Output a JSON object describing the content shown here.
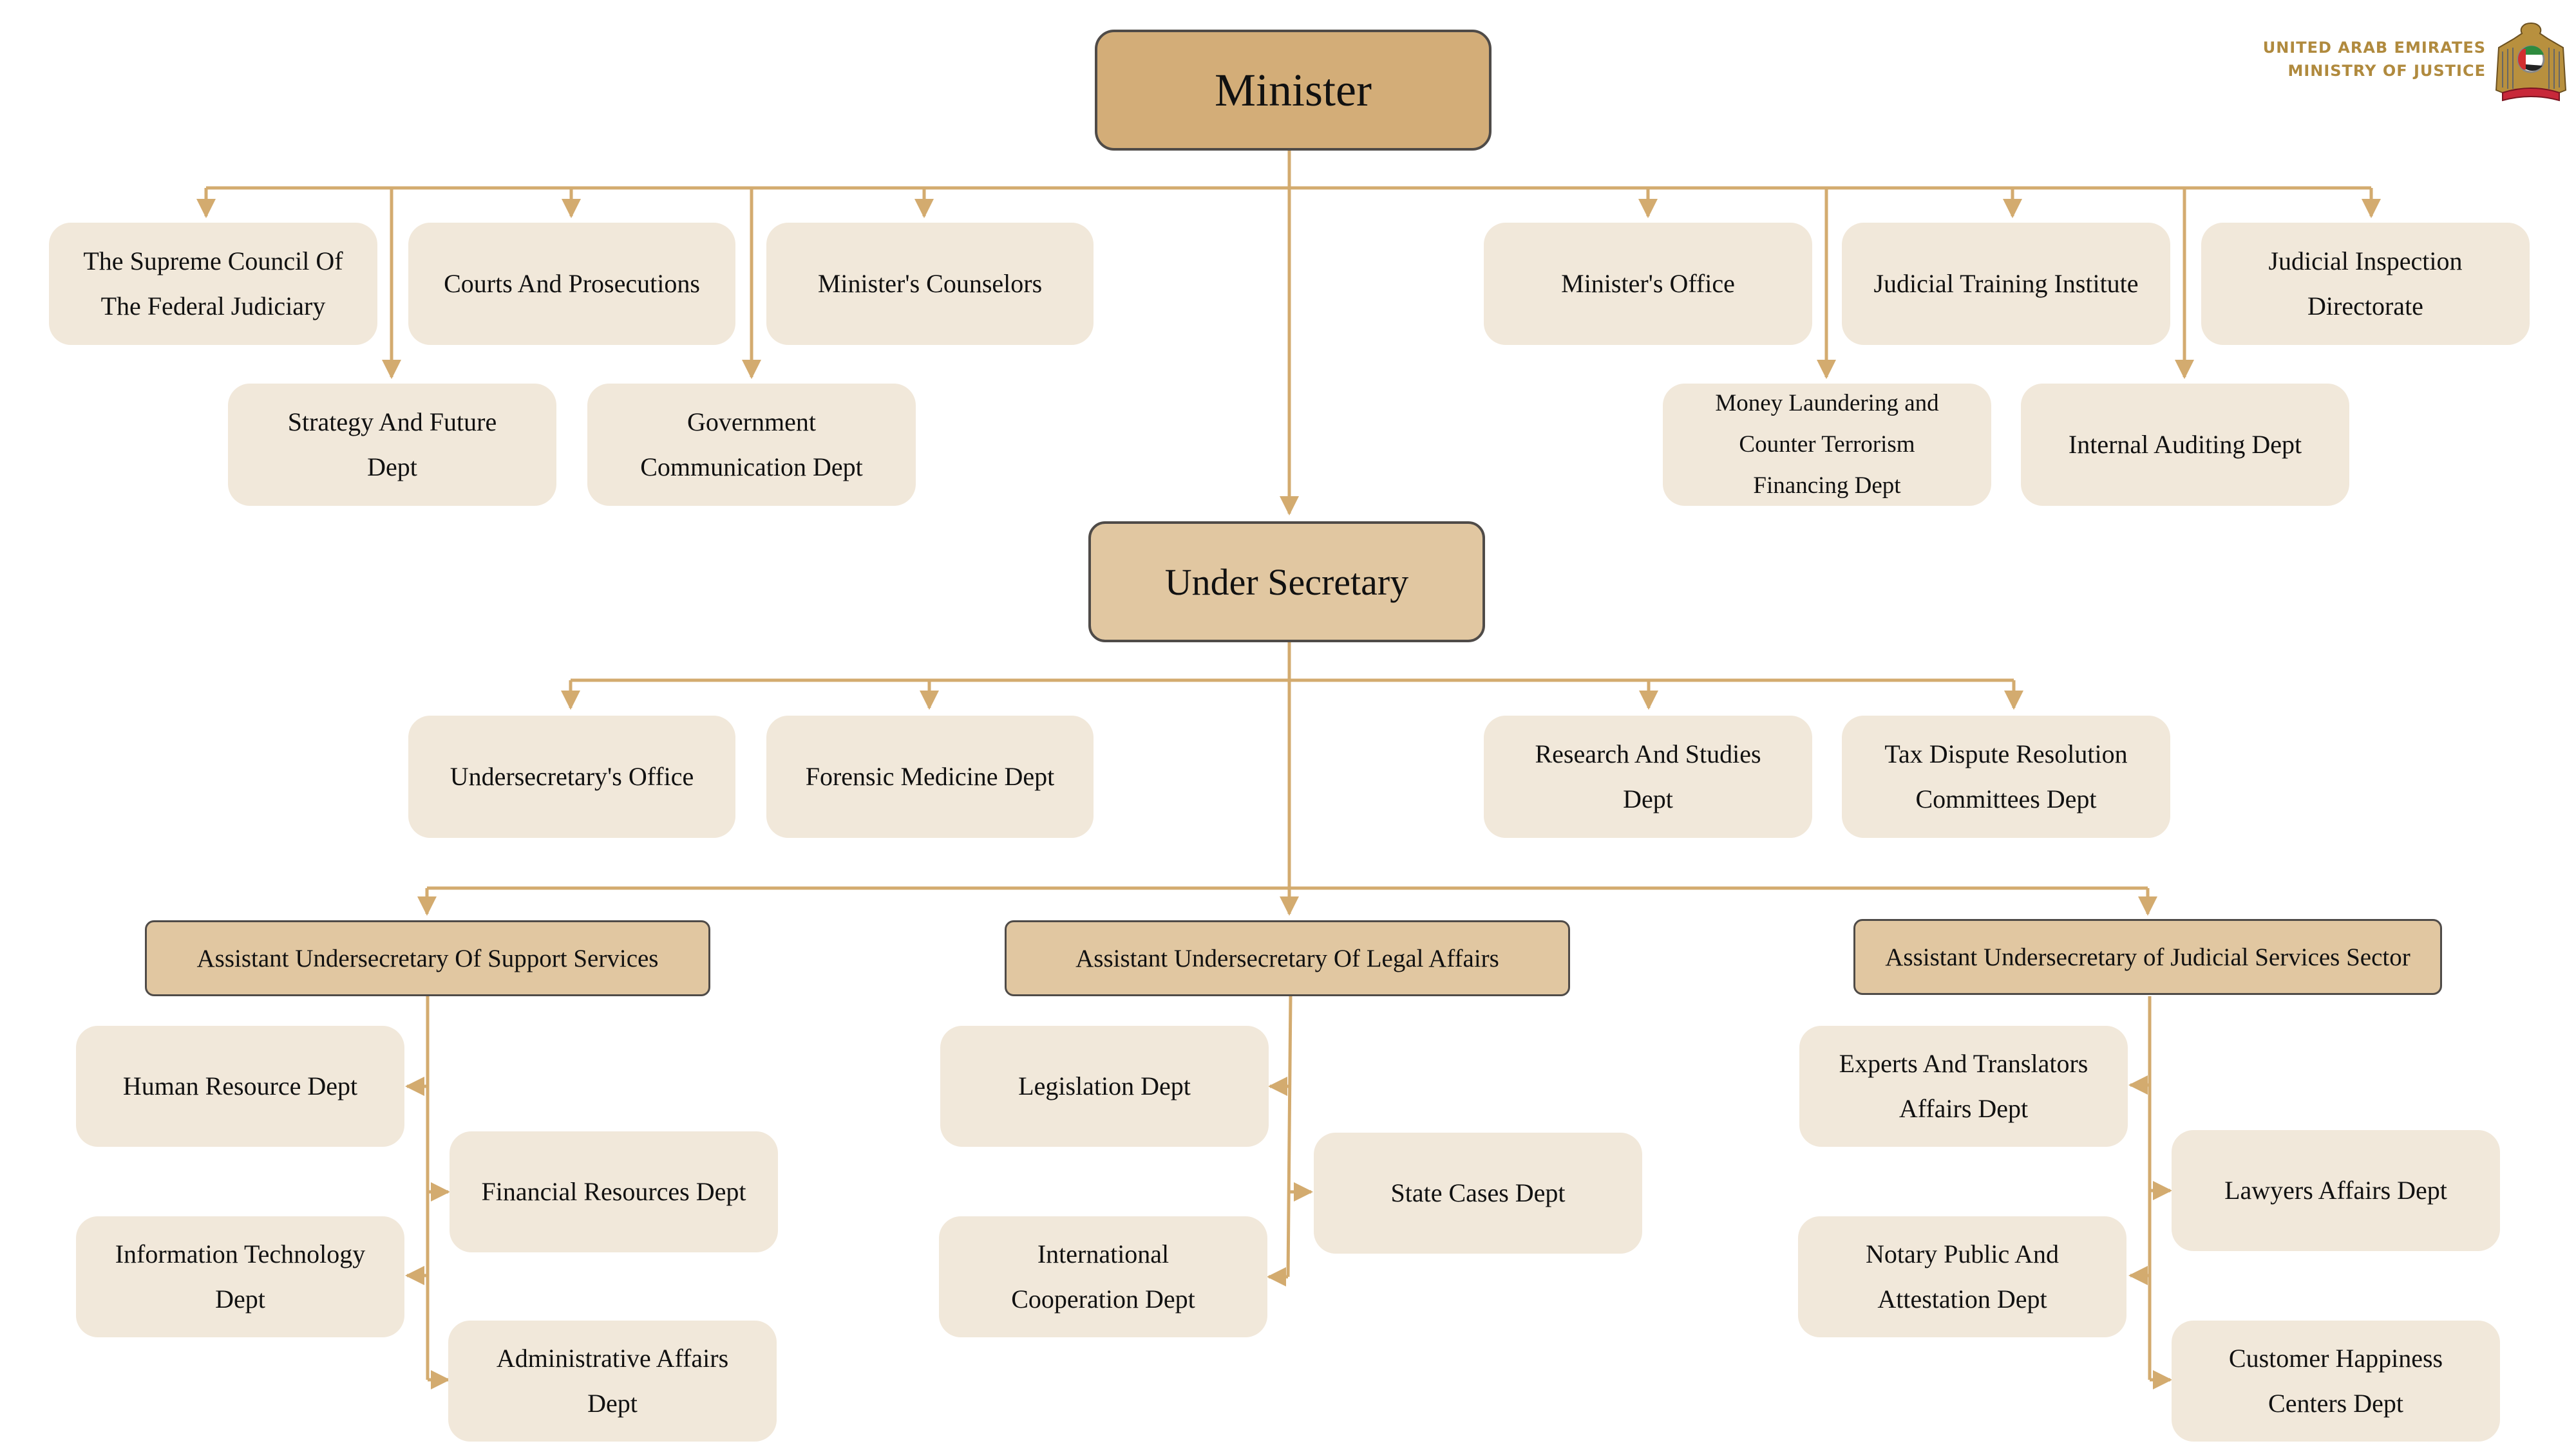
{
  "branding": {
    "line1": "UNITED ARAB EMIRATES",
    "line2": "MINISTRY OF JUSTICE",
    "emblem": "uae-federal-emblem"
  },
  "colors": {
    "connector": "#d3ab6f",
    "top_node": "#d3ad78",
    "secondary_node": "#e1c7a1",
    "dept_node": "#f1e8da",
    "node_border": "#4f4b48",
    "brand_text": "#b08a3e"
  },
  "minister": {
    "title": "Minister",
    "direct_units": [
      "The Supreme Council Of The Federal Judiciary",
      "Courts And Prosecutions",
      "Minister's Counselors",
      "Minister's Office",
      "Judicial Training Institute",
      "Judicial Inspection Directorate",
      "Strategy And Future Dept",
      "Government Communication Dept",
      "Money Laundering and Counter Terrorism Financing Dept",
      "Internal Auditing Dept"
    ]
  },
  "under_secretary": {
    "title": "Under Secretary",
    "direct_units": [
      "Undersecretary's Office",
      "Forensic Medicine Dept",
      "Research And Studies Dept",
      "Tax Dispute Resolution Committees Dept"
    ]
  },
  "assistant_sectors": [
    {
      "title": "Assistant Undersecretary Of Support Services",
      "depts": [
        "Human Resource Dept",
        "Financial Resources Dept",
        "Information Technology Dept",
        "Administrative Affairs Dept"
      ]
    },
    {
      "title": "Assistant Undersecretary Of Legal Affairs",
      "depts": [
        "Legislation Dept",
        "State Cases Dept",
        "International Cooperation Dept"
      ]
    },
    {
      "title": "Assistant Undersecretary of Judicial Services Sector",
      "depts": [
        "Experts And Translators Affairs Dept",
        "Lawyers Affairs Dept",
        "Notary Public And Attestation Dept",
        "Customer Happiness Centers Dept"
      ]
    }
  ]
}
